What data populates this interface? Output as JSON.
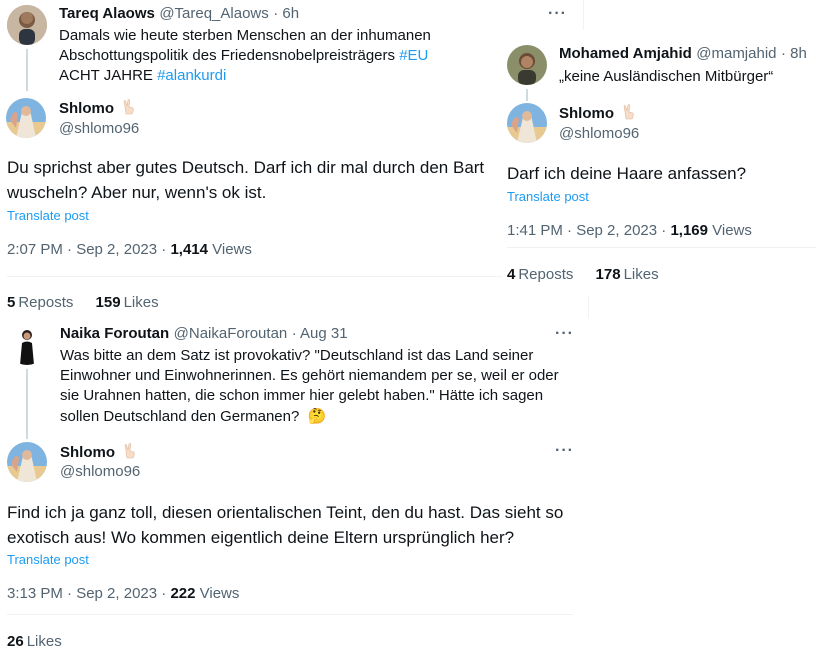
{
  "tweets": [
    {
      "quoted": {
        "name": "Tareq Alaows",
        "handle": "@Tareq_Alaows",
        "time": "· 6h",
        "text_parts": [
          "Damals wie heute sterben Menschen an der inhumanen Abschottungspolitik des Friedensnobelpreisträgers ",
          "#EU",
          "ACHT JAHRE ",
          "#alankurdi"
        ]
      },
      "reply": {
        "name": "Shlomo",
        "handle": "@shlomo96",
        "text": "Du sprichst aber gutes Deutsch. Darf ich dir mal durch den Bart wuscheln? Aber nur, wenn's ok ist.",
        "translate": "Translate post",
        "timestamp": "2:07 PM · Sep 2, 2023 · ",
        "views_count": "1,414",
        "views_label": " Views",
        "reposts_count": "5",
        "reposts_label": "Reposts",
        "likes_count": "159",
        "likes_label": "Likes"
      }
    },
    {
      "quoted": {
        "name": "Mohamed Amjahid",
        "handle": "@mamjahid",
        "time": "· 8h",
        "text": "„keine Ausländischen Mitbürger“"
      },
      "reply": {
        "name": "Shlomo",
        "handle": "@shlomo96",
        "text": "Darf ich deine Haare anfassen?",
        "translate": "Translate post",
        "timestamp": "1:41 PM · Sep 2, 2023 · ",
        "views_count": "1,169",
        "views_label": " Views",
        "reposts_count": "4",
        "reposts_label": "Reposts",
        "likes_count": "178",
        "likes_label": "Likes"
      }
    },
    {
      "quoted": {
        "name": "Naika Foroutan",
        "handle": "@NaikaForoutan",
        "time": "· Aug 31",
        "text": "Was bitte an dem Satz ist provokativ? \"Deutschland  ist das Land seiner Einwohner und Einwohnerinnen. Es gehört niemandem  per se, weil er oder sie Urahnen hatten, die schon immer hier gelebt  haben.\" Hätte ich sagen sollen Deutschland den Germanen?",
        "emoji": "🤔"
      },
      "reply": {
        "name": "Shlomo",
        "handle": "@shlomo96",
        "text": "Find ich ja ganz toll, diesen orientalischen Teint, den du hast. Das sieht so exotisch aus! Wo kommen eigentlich deine Eltern ursprünglich her?",
        "translate": "Translate post",
        "timestamp": "3:13 PM · Sep 2, 2023 · ",
        "views_count": "222",
        "views_label": " Views",
        "likes_count": "26",
        "likes_label": "Likes"
      }
    }
  ],
  "icons": {
    "more": "···",
    "peace_emoji": "peace-hand-icon"
  },
  "colors": {
    "link": "#1d9bf0",
    "muted": "#536471",
    "text": "#0f1419",
    "thread_line": "#cfd9de"
  }
}
